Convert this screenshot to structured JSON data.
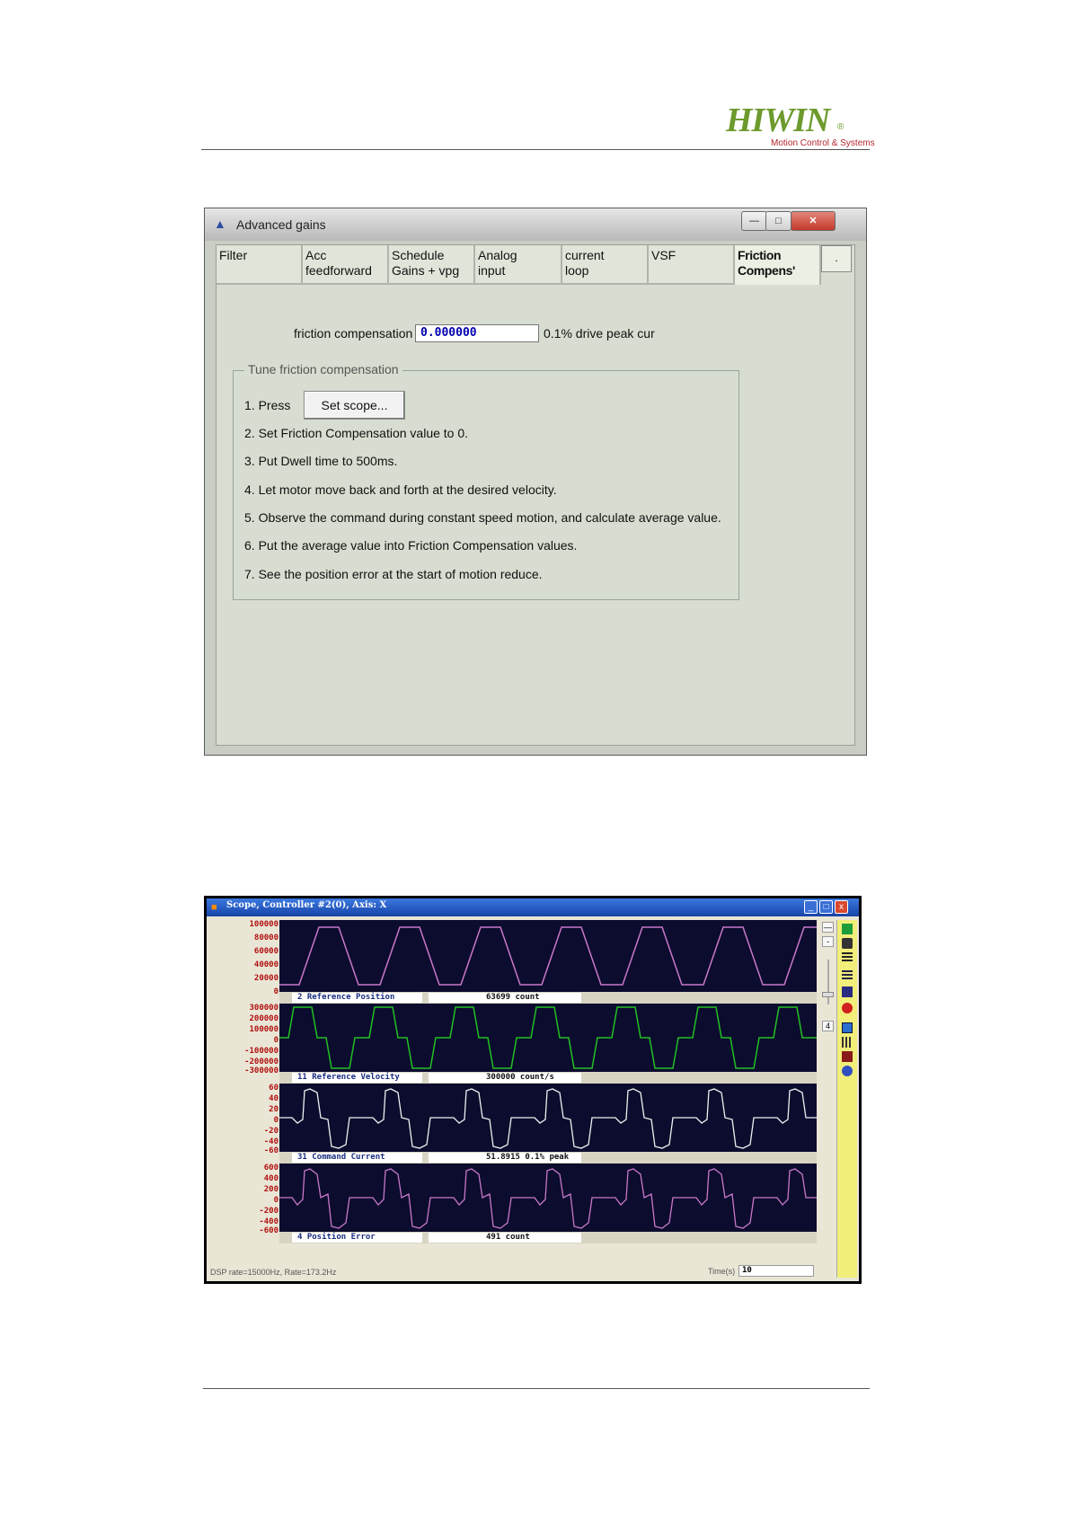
{
  "header": {
    "logo_text": "HIWIN",
    "logo_registered": "®",
    "logo_subtitle": "Motion Control & Systems",
    "brand_green": "#6d9a2c",
    "brand_red": "#b3262b"
  },
  "advanced_gains": {
    "title": "Advanced gains",
    "window_buttons": {
      "minimize": "—",
      "maximize": "□",
      "close": "✕"
    },
    "tabs": [
      {
        "line1": "Filter",
        "line2": ""
      },
      {
        "line1": "Acc",
        "line2": "feedforward"
      },
      {
        "line1": "Schedule",
        "line2": "Gains + vpg"
      },
      {
        "line1": "Analog",
        "line2": "input"
      },
      {
        "line1": "current",
        "line2": "loop"
      },
      {
        "line1": "VSF",
        "line2": ""
      },
      {
        "line1": "Friction",
        "line2": "Compens'"
      }
    ],
    "active_tab": "Friction Compens'",
    "more_tab": ".",
    "friction_compensation": {
      "label": "friction compensation",
      "value": "0.000000",
      "unit": "0.1% drive peak cur"
    },
    "tune_group": {
      "title": "Tune friction compensation",
      "step1_prefix": "1. Press",
      "set_scope_button": "Set scope...",
      "steps": [
        "2. Set Friction Compensation value to 0.",
        "3. Put Dwell time to 500ms.",
        "4. Let motor move back and forth at the desired velocity.",
        "5. Observe the command during constant speed motion, and calculate average value.",
        "6. Put the average value into Friction Compensation values.",
        "7. See the position error at the start of motion reduce."
      ]
    }
  },
  "scope": {
    "title": "Scope, Controller #2(0), Axis: X",
    "window_buttons": {
      "minimize": "_",
      "maximize": "□",
      "close": "x"
    },
    "channels": [
      {
        "name": "2 Reference Position",
        "value": "63699 count",
        "color": "#c878c8",
        "y_ticks": [
          "100000",
          "80000",
          "60000",
          "40000",
          "20000",
          "0"
        ]
      },
      {
        "name": "11 Reference Velocity",
        "value": "300000 count/s",
        "color": "#22c022",
        "y_ticks": [
          "300000",
          "200000",
          "100000",
          "0",
          "-100000",
          "-200000",
          "-300000"
        ]
      },
      {
        "name": "31 Command Current",
        "value": "51.8915 0.1% peak",
        "color": "#f0f0f0",
        "y_ticks": [
          "60",
          "40",
          "20",
          "0",
          "-20",
          "-40",
          "-60"
        ]
      },
      {
        "name": "4 Position Error",
        "value": "491 count",
        "color": "#c878c8",
        "y_ticks": [
          "600",
          "400",
          "200",
          "0",
          "-200",
          "-400",
          "-600"
        ]
      }
    ],
    "side_controls": {
      "zoom_in": "—",
      "zoom_out": "-",
      "channel_count": "4"
    },
    "toolbar_icons": [
      "start-icon",
      "camera-icon",
      "grid-icon",
      "list-icon",
      "channel-icon",
      "stop-icon",
      "save-icon",
      "bars-icon",
      "settings-icon",
      "help-icon"
    ],
    "status": "DSP rate=15000Hz, Rate=173.2Hz",
    "time_label": "Time(s)",
    "time_value": "10"
  }
}
